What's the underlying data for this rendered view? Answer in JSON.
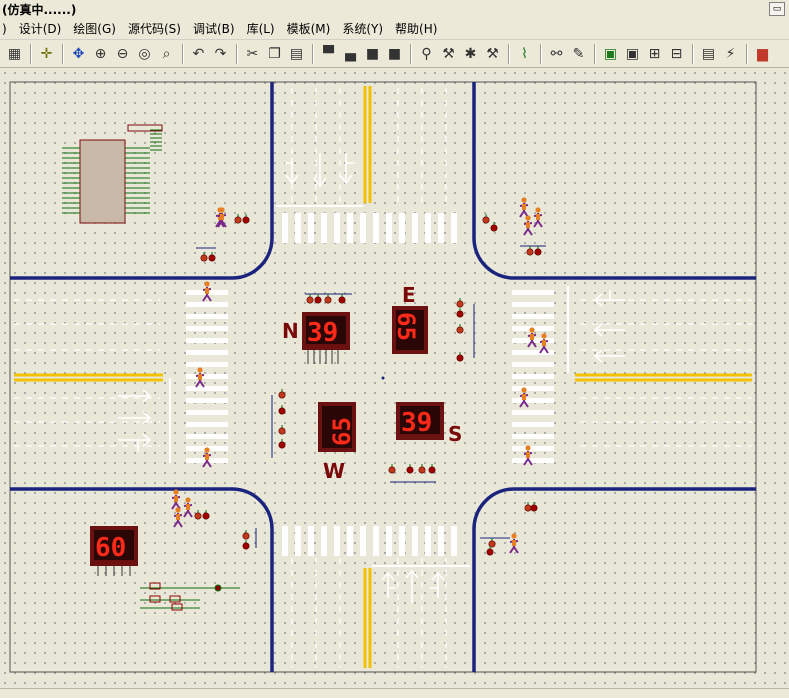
{
  "window": {
    "title": "(仿真中......)"
  },
  "menu": {
    "items": [
      "设计(D)",
      "绘图(G)",
      "源代码(S)",
      "调试(B)",
      "库(L)",
      "模板(M)",
      "系统(Y)",
      "帮助(H)"
    ]
  },
  "toolbar": {
    "icons": [
      "grid-icon",
      "origin-icon",
      "pan-icon",
      "zoom-in-icon",
      "zoom-out-icon",
      "zoom-all-icon",
      "zoom-area-icon",
      "undo-icon",
      "redo-icon",
      "cut-icon",
      "copy-icon",
      "paste-icon",
      "block-copy-icon",
      "block-move-icon",
      "block-rotate-icon",
      "block-delete-icon",
      "pick-device-icon",
      "make-device-icon",
      "package-icon",
      "decompose-icon",
      "wire-autoroute-icon",
      "search-icon",
      "property-assign-icon",
      "new-sheet-icon",
      "remove-sheet-icon",
      "netlist-icon",
      "bom-icon",
      "erc-icon",
      "ares-icon"
    ]
  },
  "intersection": {
    "direction_labels": {
      "north": "N",
      "east": "E",
      "west": "W",
      "south": "S"
    },
    "displays": {
      "north": "39",
      "east": "65",
      "west": "65",
      "south": "39",
      "controller": "60"
    }
  },
  "colors": {
    "road_edge": "#1a237e",
    "center_line": "#f2c200",
    "display_frame": "#6b1111",
    "segment_on": "#ff2a1a",
    "label": "#8b0000"
  }
}
